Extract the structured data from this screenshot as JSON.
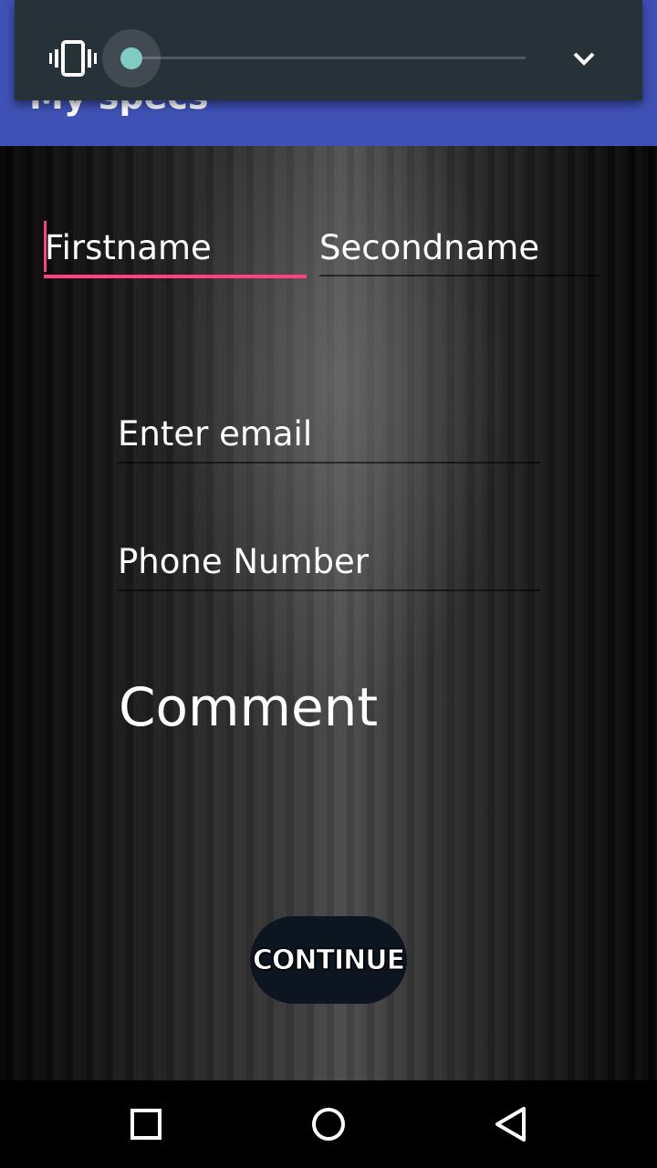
{
  "appbar": {
    "title": "My specs"
  },
  "form": {
    "firstname_placeholder": "Firstname",
    "secondname_placeholder": "Secondname",
    "email_placeholder": "Enter email",
    "phone_placeholder": "Phone Number",
    "comment_label": "Comment",
    "continue_label": "CONTINUE"
  },
  "volume": {
    "level": 0,
    "mode_icon": "vibrate-icon",
    "expand_icon": "chevron-down-icon"
  },
  "navbar": {
    "recents_icon": "square-recents-icon",
    "home_icon": "circle-home-icon",
    "back_icon": "triangle-back-icon"
  },
  "colors": {
    "primary": "#3f51b5",
    "accent": "#ff4081",
    "volume_panel": "#263238",
    "slider_thumb": "#80cbc4"
  }
}
